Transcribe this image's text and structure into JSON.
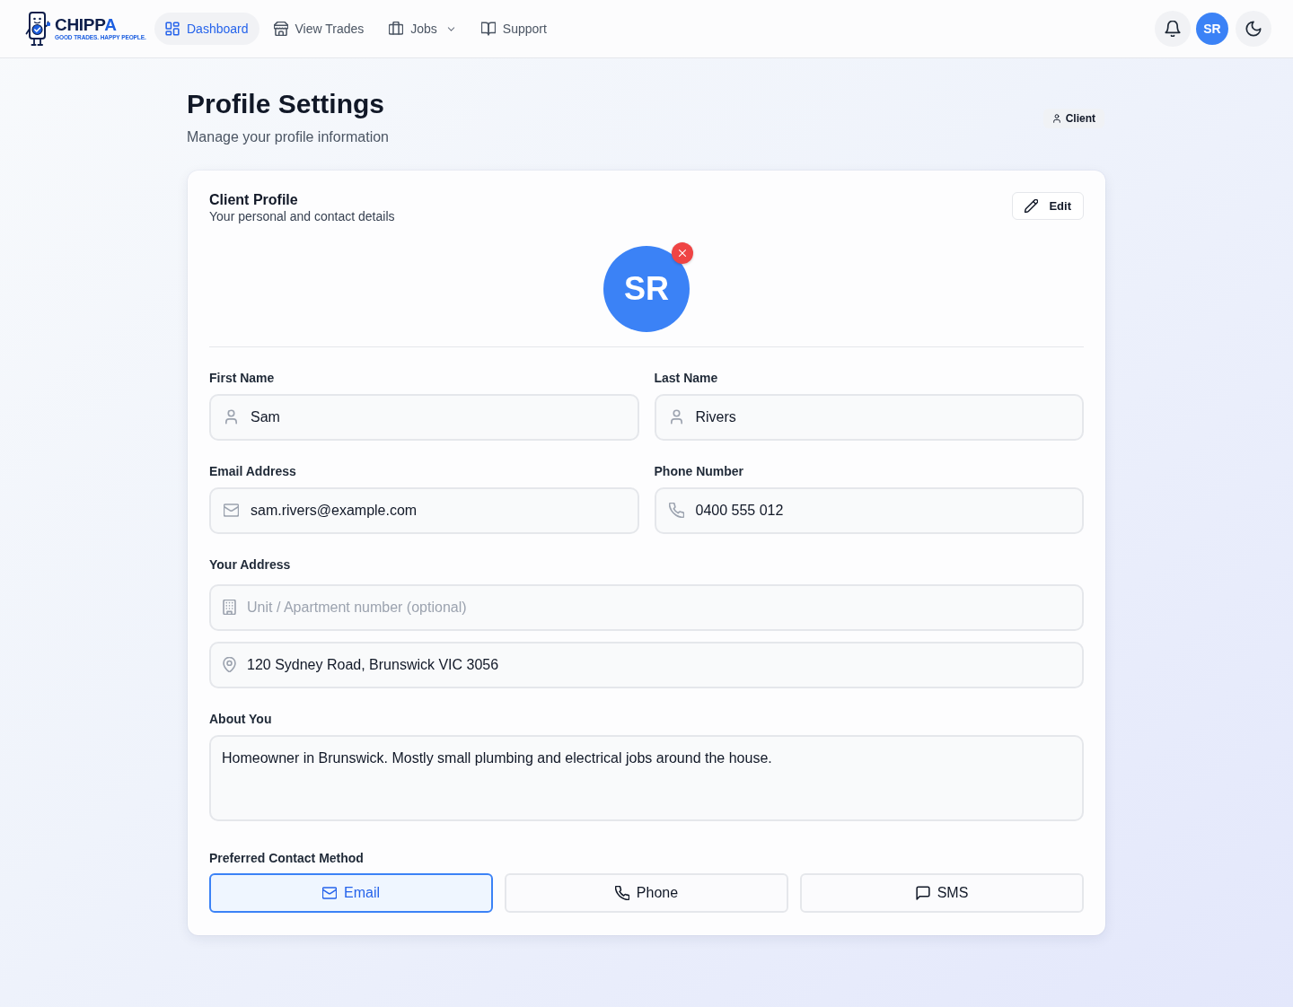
{
  "header": {
    "logo": {
      "wordmark": "CHIPPA",
      "tagline": "GOOD TRADES. HAPPY PEOPLE."
    },
    "nav": [
      {
        "label": "Dashboard",
        "selected": true,
        "has_menu": false
      },
      {
        "label": "View Trades",
        "selected": false,
        "has_menu": false
      },
      {
        "label": "Jobs",
        "selected": false,
        "has_menu": true
      },
      {
        "label": "Support",
        "selected": false,
        "has_menu": false
      }
    ],
    "user_avatar": "SR"
  },
  "page": {
    "title": "Profile Settings",
    "subtitle": "Manage your profile information",
    "role_badge": "Client"
  },
  "card": {
    "title": "Client Profile",
    "subtitle": "Your personal and contact details",
    "edit_button": "Edit",
    "avatar_initials": "SR",
    "fields": [
      {
        "kind": "first_name",
        "label": "First Name",
        "value": "Sam"
      },
      {
        "kind": "last_name",
        "label": "Last Name",
        "value": "Rivers"
      },
      {
        "kind": "email",
        "label": "Email Address",
        "value": "sam.rivers@example.com"
      },
      {
        "kind": "phone",
        "label": "Phone Number",
        "value": "0400 555 012"
      }
    ],
    "address": {
      "label": "Your Address",
      "unit": {
        "placeholder": "Unit / Apartment number (optional)"
      },
      "street": {
        "value": "120 Sydney Road, Brunswick VIC 3056"
      }
    },
    "about": {
      "label": "About You",
      "value": "Homeowner in Brunswick. Mostly small plumbing and electrical jobs around the house."
    },
    "contact_method": {
      "label": "Preferred Contact Method",
      "options": [
        {
          "kind": "email",
          "label": "Email",
          "selected": true
        },
        {
          "kind": "phone",
          "label": "Phone",
          "selected": false
        },
        {
          "kind": "sms",
          "label": "SMS",
          "selected": false
        }
      ]
    }
  }
}
